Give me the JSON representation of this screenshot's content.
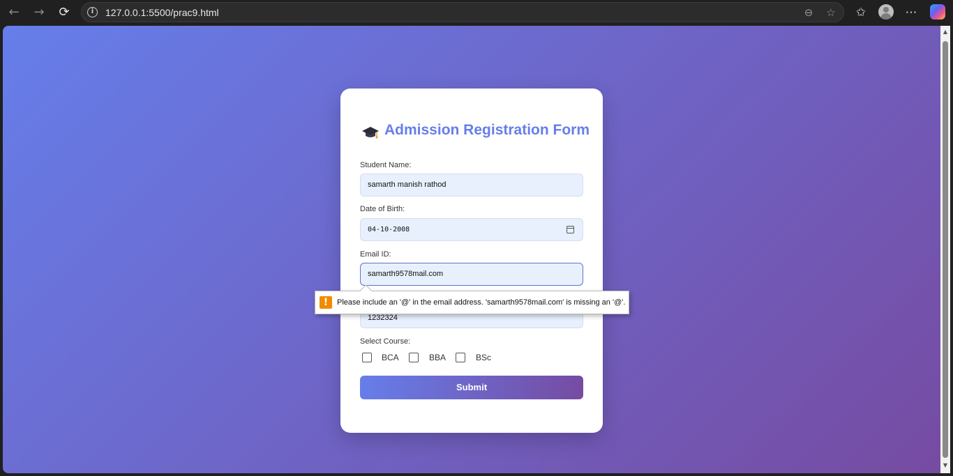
{
  "browser": {
    "url": "127.0.0.1:5500/prac9.html"
  },
  "form": {
    "title": "Admission Registration Form",
    "fields": {
      "student_name": {
        "label": "Student Name:",
        "value": "samarth manish rathod"
      },
      "dob": {
        "label": "Date of Birth:",
        "value": "04-10-2008"
      },
      "email": {
        "label": "Email ID:",
        "value": "samarth9578mail.com"
      },
      "phone": {
        "value": "1232324"
      }
    },
    "course": {
      "label": "Select Course:",
      "options": [
        "BCA",
        "BBA",
        "BSc"
      ]
    },
    "submit_label": "Submit"
  },
  "validation": {
    "message": "Please include an '@' in the email address. 'samarth9578mail.com' is missing an '@'."
  },
  "colors": {
    "gradient_start": "#667eea",
    "gradient_end": "#764ba2",
    "title": "#667eea",
    "warning": "#f08c00"
  }
}
